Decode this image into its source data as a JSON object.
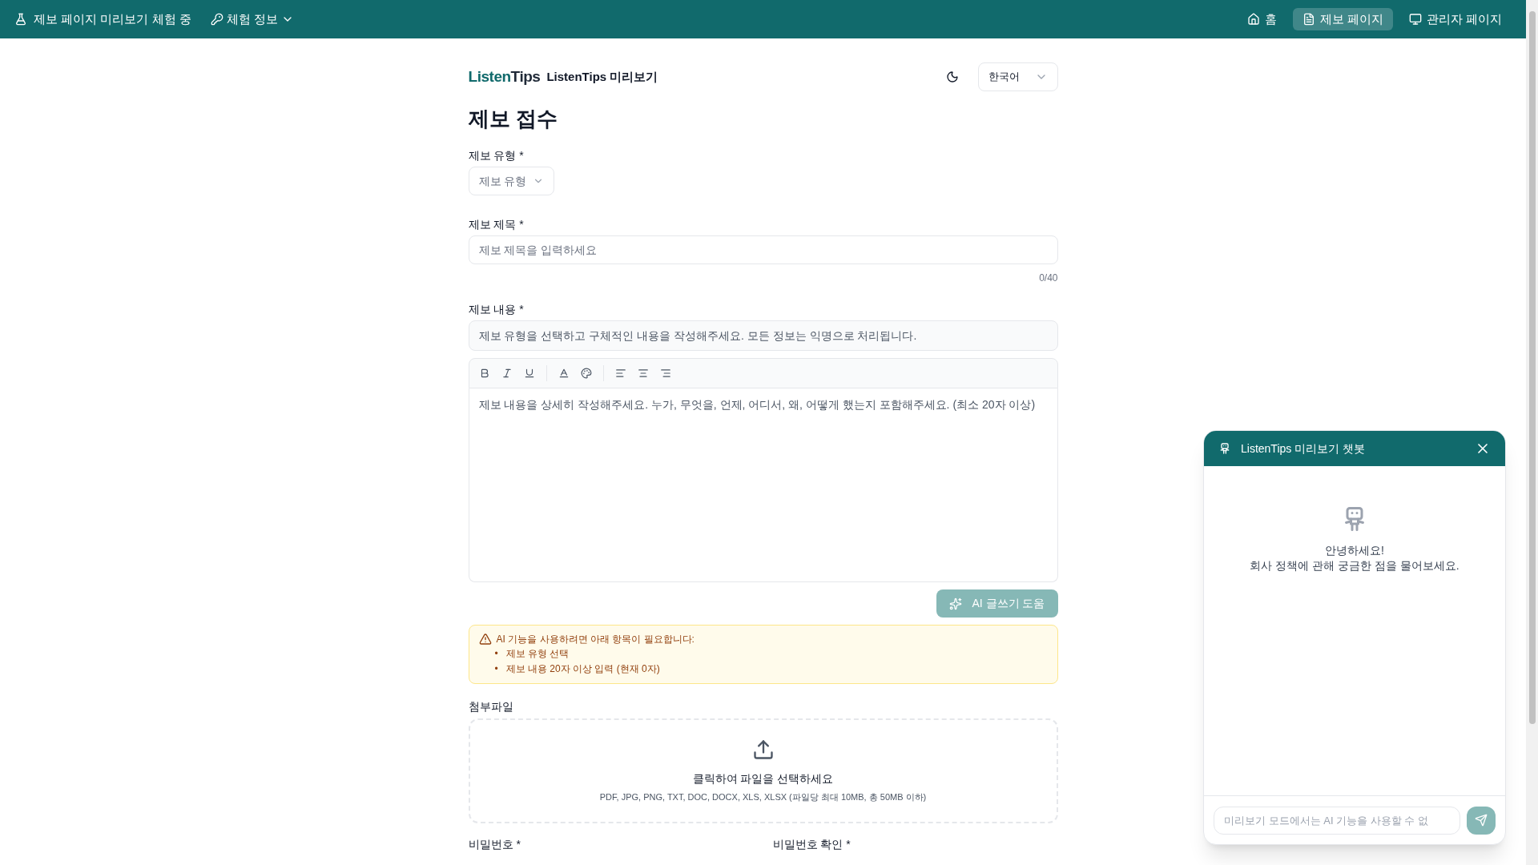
{
  "topbar": {
    "badge": "제보 페이지 미리보기 체험 중",
    "info_menu": "체험 정보",
    "nav": [
      {
        "kind": "home",
        "label": "홈",
        "selected": false
      },
      {
        "kind": "document",
        "label": "제보 페이지",
        "selected": true
      },
      {
        "kind": "monitor",
        "label": "관리자 페이지",
        "selected": false
      }
    ]
  },
  "header": {
    "logo": {
      "primary": "Listen",
      "secondary": "Tips"
    },
    "subtitle": "ListenTips 미리보기",
    "language": "한국어"
  },
  "form": {
    "title": "제보 접수",
    "type_field": {
      "label": "제보 유형 *",
      "placeholder": "제보 유형"
    },
    "title_field": {
      "label": "제보 제목 *",
      "placeholder": "제보 제목을 입력하세요",
      "counter": "0/40"
    },
    "content_field": {
      "label": "제보 내용 *",
      "description": "제보 유형을 선택하고 구체적인 내용을 작성해주세요. 모든 정보는 익명으로 처리됩니다.",
      "placeholder": "제보 내용을 상세히 작성해주세요. 누가, 무엇을, 언제, 어디서, 왜, 어떻게 했는지 포함해주세요. (최소 20자 이상)"
    },
    "ai_button": {
      "label": "AI 글쓰기 도움",
      "disabled": true
    },
    "warning": {
      "message": "AI 기능을 사용하려면 아래 항목이 필요합니다:",
      "bullet": "•",
      "items": [
        "제보 유형 선택",
        "제보 내용 20자 이상 입력 (현재 0자)"
      ]
    },
    "attachment": {
      "label": "첨부파일",
      "prompt": "클릭하여 파일을 선택하세요",
      "hint": "PDF, JPG, PNG, TXT, DOC, DOCX, XLS, XLSX (파일당 최대 10MB, 총 50MB 이하)"
    },
    "password_labels": [
      "비밀번호 *",
      "비밀번호 확인 *"
    ]
  },
  "chatbot": {
    "title": "ListenTips 미리보기 챗봇",
    "greeting": [
      "안녕하세요!",
      "회사 정책에 관해 궁금한 점을 물어보세요."
    ],
    "placeholder": "미리보기 모드에서는 AI 기능을 사용할 수 없",
    "send_disabled": true
  }
}
